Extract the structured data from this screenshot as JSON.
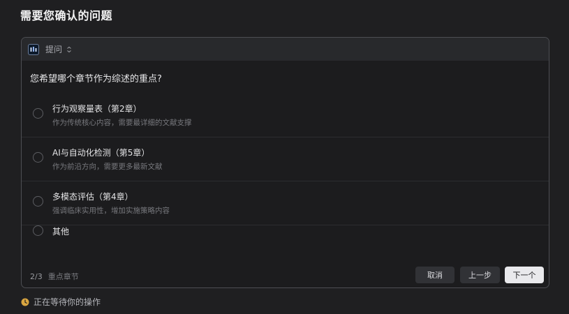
{
  "page": {
    "title": "需要您确认的问题"
  },
  "card": {
    "header_label": "提问",
    "app_icon": "app-logo-icon",
    "collapse_icon": "chevron-up-down-icon",
    "question": "您希望哪个章节作为综述的重点?",
    "options": [
      {
        "title": "行为观察量表（第2章）",
        "desc": "作为传统核心内容，需要最详细的文献支撑"
      },
      {
        "title": "AI与自动化检测（第5章）",
        "desc": "作为前沿方向，需要更多最新文献"
      },
      {
        "title": "多模态评估（第4章）",
        "desc": "强调临床实用性，增加实施策略内容"
      },
      {
        "title": "其他",
        "desc": ""
      }
    ],
    "footer": {
      "progress": "2/3",
      "step_name": "重点章节",
      "cancel_label": "取消",
      "prev_label": "上一步",
      "next_label": "下一个"
    }
  },
  "status": {
    "icon": "clock-icon",
    "text": "正在等待你的操作",
    "icon_color": "#d9a540"
  },
  "colors": {
    "background": "#1f1f21",
    "card_header": "#28292c",
    "primary_button": "#e9e9ec"
  }
}
